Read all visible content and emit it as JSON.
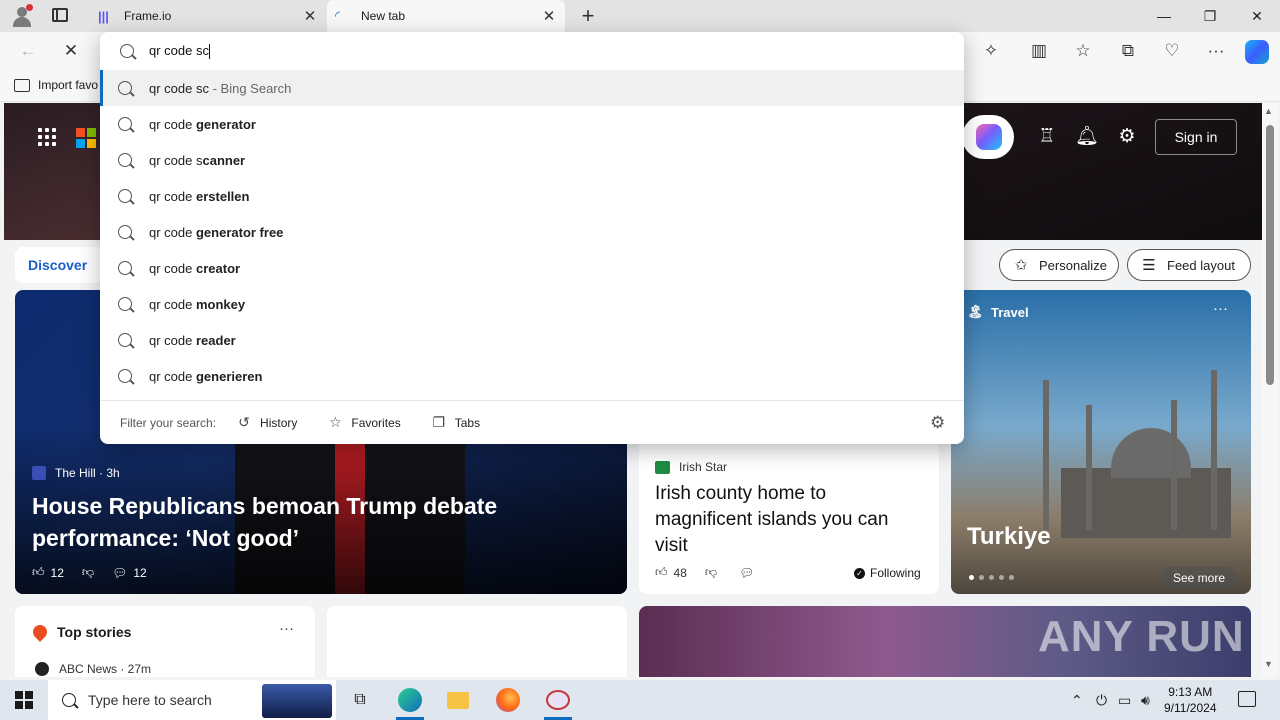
{
  "browser": {
    "tabs": [
      {
        "label": "Frame.io",
        "favicon": "frameio-icon"
      },
      {
        "label": "New tab",
        "favicon": "edge-loading-icon"
      }
    ],
    "new_tab_symbol": "+",
    "address_value": "qr code sc",
    "favorites_bar": {
      "import_label": "Import favo"
    }
  },
  "omnibox": {
    "suggestions": [
      {
        "prefix": "qr code sc",
        "bold": "",
        "meta": " - Bing Search"
      },
      {
        "prefix": "qr code ",
        "bold": "generator",
        "meta": ""
      },
      {
        "prefix": "qr code s",
        "bold": "canner",
        "meta": ""
      },
      {
        "prefix": "qr code ",
        "bold": "erstellen",
        "meta": ""
      },
      {
        "prefix": "qr code ",
        "bold": "generator free",
        "meta": ""
      },
      {
        "prefix": "qr code ",
        "bold": "creator",
        "meta": ""
      },
      {
        "prefix": "qr code ",
        "bold": "monkey",
        "meta": ""
      },
      {
        "prefix": "qr code ",
        "bold": "reader",
        "meta": ""
      },
      {
        "prefix": "qr code ",
        "bold": "generieren",
        "meta": ""
      }
    ],
    "filter": {
      "label": "Filter your search:",
      "chips": [
        "History",
        "Favorites",
        "Tabs"
      ]
    }
  },
  "newtab": {
    "signin": "Sign in",
    "discover": "Discover",
    "personalize": "Personalize",
    "feed_layout": "Feed layout",
    "hero_card": {
      "source": "The Hill · 3h",
      "headline": "House Republicans bemoan Trump debate performance: ‘Not good’",
      "likes": "12",
      "comments": "12"
    },
    "irish_card": {
      "source": "Irish Star",
      "headline": "Irish county home to magnificent islands you can visit",
      "likes": "48",
      "following": "Following"
    },
    "travel_card": {
      "label": "Travel",
      "more": "···",
      "city": "Turkiye",
      "see_more": "See more"
    },
    "top_stories": {
      "title": "Top stories",
      "more": "···",
      "source": "ABC News · 27m"
    }
  },
  "watermark": "ANY RUN",
  "taskbar": {
    "search_placeholder": "Type here to search",
    "time": "9:13 AM",
    "date": "9/11/2024"
  }
}
